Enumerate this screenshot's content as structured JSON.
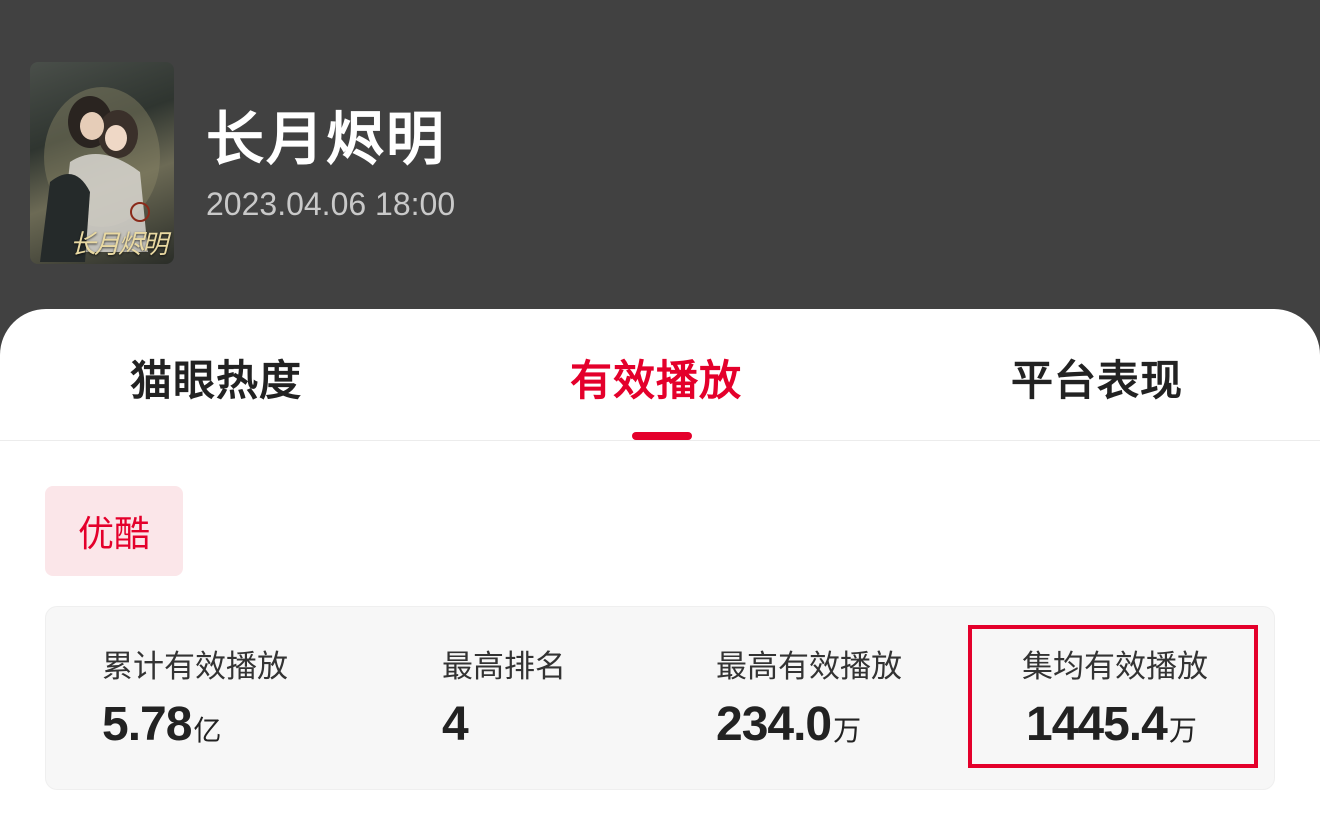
{
  "show": {
    "title": "长月烬明",
    "release_time": "2023.04.06 18:00",
    "poster_caption": "长月烬明"
  },
  "tabs": [
    {
      "label": "猫眼热度",
      "active": false
    },
    {
      "label": "有效播放",
      "active": true
    },
    {
      "label": "平台表现",
      "active": false
    }
  ],
  "platform": {
    "label": "优酷"
  },
  "stats": [
    {
      "label": "累计有效播放",
      "value": "5.78",
      "unit": "亿",
      "highlighted": false
    },
    {
      "label": "最高排名",
      "value": "4",
      "unit": "",
      "highlighted": false
    },
    {
      "label": "最高有效播放",
      "value": "234.0",
      "unit": "万",
      "highlighted": false
    },
    {
      "label": "集均有效播放",
      "value": "1445.4",
      "unit": "万",
      "highlighted": true
    }
  ],
  "colors": {
    "accent": "#e4002b",
    "header_bg": "#414141",
    "chip_bg": "#fbe6e9",
    "stats_bg": "#f7f7f7"
  }
}
